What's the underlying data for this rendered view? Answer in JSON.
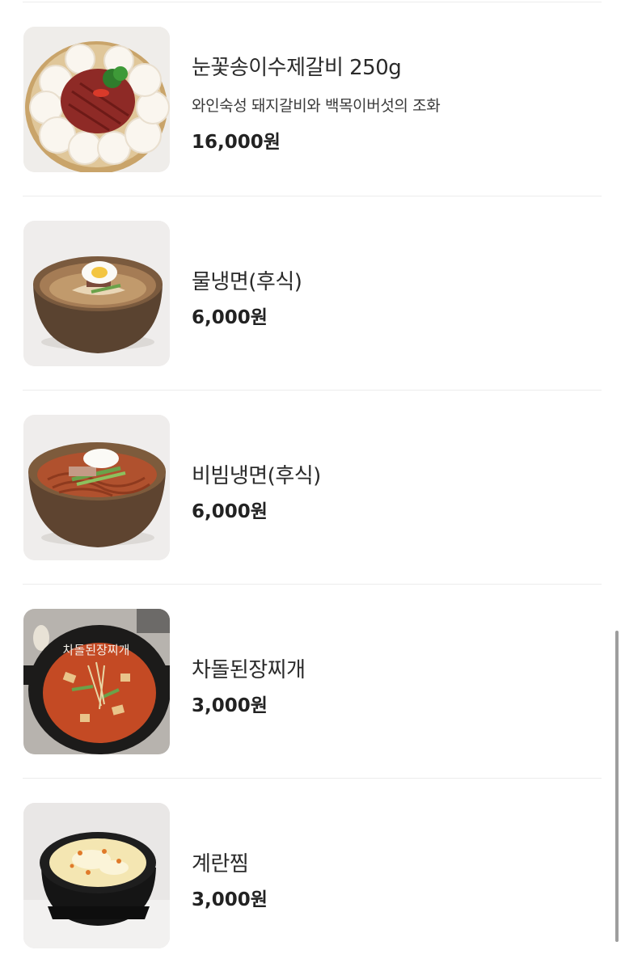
{
  "menu": {
    "items": [
      {
        "name": "눈꽃송이수제갈비 250g",
        "description": "와인숙성 돼지갈비와 백목이버섯의 조화",
        "price": "16,000원",
        "image_icon": "galbi-photo"
      },
      {
        "name": "물냉면(후식)",
        "price": "6,000원",
        "image_icon": "mul-naengmyeon-photo"
      },
      {
        "name": "비빔냉면(후식)",
        "price": "6,000원",
        "image_icon": "bibim-naengmyeon-photo"
      },
      {
        "name": "차돌된장찌개",
        "price": "3,000원",
        "image_icon": "doenjang-jjigae-photo",
        "image_text": "차돌된장찌개"
      },
      {
        "name": "계란찜",
        "price": "3,000원",
        "image_icon": "gyeran-jjim-photo"
      }
    ]
  },
  "colors": {
    "divider": "#ececec",
    "text": "#2a2a2a",
    "scrollbar": "#9e9e9e"
  }
}
